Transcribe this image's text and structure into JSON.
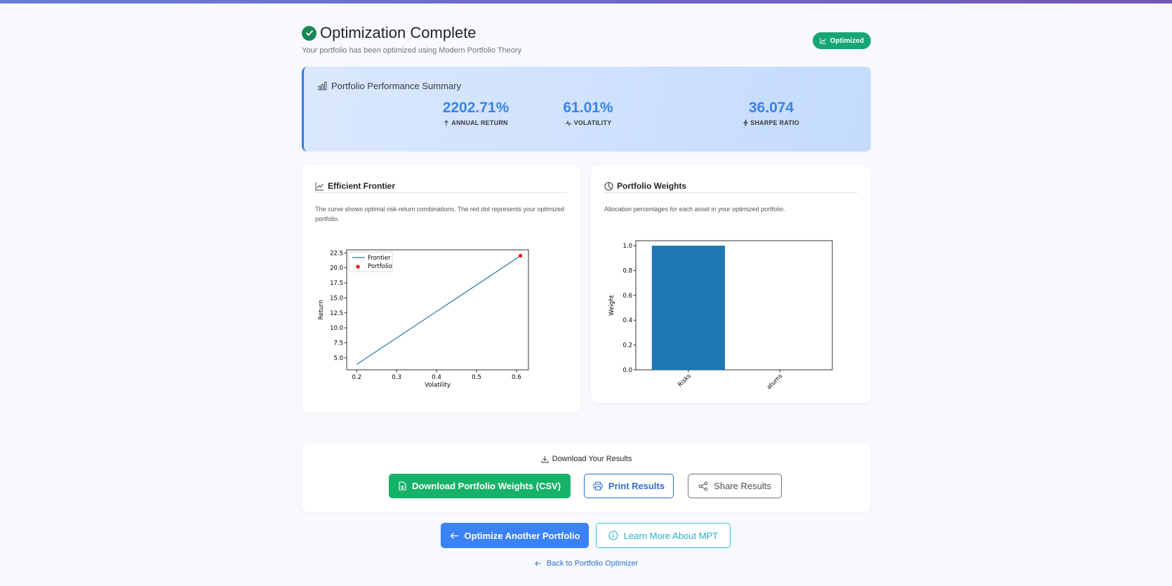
{
  "header": {
    "title": "Optimization Complete",
    "subtitle": "Your portfolio has been optimized using Modern Portfolio Theory",
    "badge": "Optimized"
  },
  "summary": {
    "title": "Portfolio Performance Summary",
    "metrics": [
      {
        "value": "2202.71%",
        "label": "ANNUAL RETURN",
        "icon": "arrow-up-icon"
      },
      {
        "value": "61.01%",
        "label": "VOLATILITY",
        "icon": "pulse-icon"
      },
      {
        "value": "36.074",
        "label": "SHARPE RATIO",
        "icon": "lightning-icon"
      }
    ]
  },
  "frontier_card": {
    "title": "Efficient Frontier",
    "description": "The curve shows optimal risk-return combinations. The red dot represents your optimized portfolio."
  },
  "weights_card": {
    "title": "Portfolio Weights",
    "description": "Allocation percentages for each asset in your optimized portfolio."
  },
  "downloads": {
    "title": "Download Your Results",
    "csv_label": "Download Portfolio Weights (CSV)",
    "print_label": "Print Results",
    "share_label": "Share Results"
  },
  "actions": {
    "optimize_label": "Optimize Another Portfolio",
    "learn_label": "Learn More About MPT",
    "back_label": "Back to Portfolio Optimizer"
  },
  "colors": {
    "accent": "#3b82f6",
    "success": "#17b26a",
    "frontier_line": "#1f77b4",
    "portfolio_dot": "#ff0000",
    "bar": "#1f77b4"
  },
  "chart_data": [
    {
      "type": "line",
      "xlabel": "Volatility",
      "ylabel": "Return",
      "xlim": [
        0.175,
        0.63
      ],
      "ylim": [
        3.0,
        23.0
      ],
      "xticks": [
        0.2,
        0.3,
        0.4,
        0.5,
        0.6
      ],
      "xtick_labels": [
        "0.2",
        "0.3",
        "0.4",
        "0.5",
        "0.6"
      ],
      "yticks": [
        5.0,
        7.5,
        10.0,
        12.5,
        15.0,
        17.5,
        20.0,
        22.5
      ],
      "ytick_labels": [
        "5.0",
        "7.5",
        "10.0",
        "12.5",
        "15.0",
        "17.5",
        "20.0",
        "22.5"
      ],
      "legend_position": "top-left",
      "series": [
        {
          "name": "Frontier",
          "kind": "line",
          "x": [
            0.2,
            0.61
          ],
          "y": [
            3.9,
            22.0
          ]
        },
        {
          "name": "Portfolio",
          "kind": "scatter",
          "x": [
            0.61
          ],
          "y": [
            22.03
          ]
        }
      ]
    },
    {
      "type": "bar",
      "categories": [
        "Risks",
        "Returns"
      ],
      "tick_labels": [
        "Risks",
        "aturns"
      ],
      "values": [
        1.0,
        0.0
      ],
      "ylabel": "Weight",
      "ylim": [
        0.0,
        1.04
      ],
      "yticks": [
        0.0,
        0.2,
        0.4,
        0.6,
        0.8,
        1.0
      ],
      "ytick_labels": [
        "0.0",
        "0.2",
        "0.4",
        "0.6",
        "0.8",
        "1.0"
      ]
    }
  ]
}
